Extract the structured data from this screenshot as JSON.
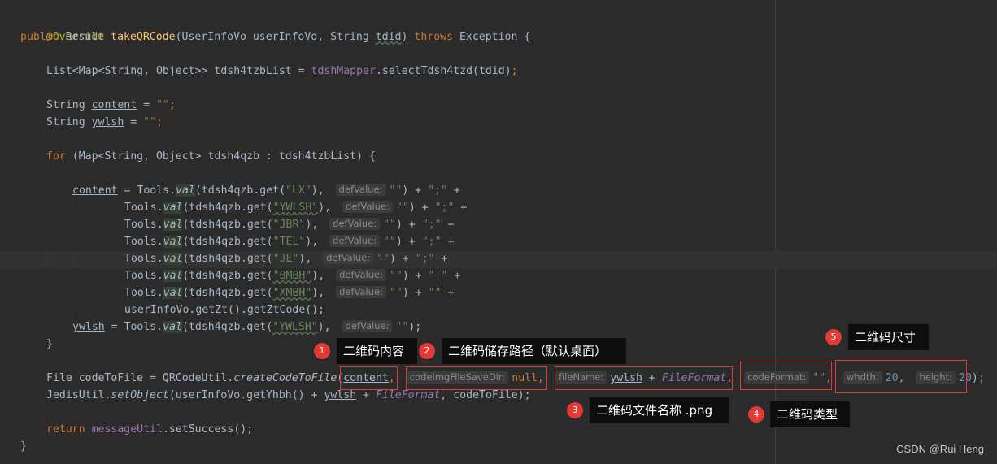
{
  "code": {
    "l1_annotation": "@Override",
    "l2": {
      "kw_public": "public",
      "type_result": " Result ",
      "method": "takeQRCode",
      "params": "(UserInfoVo userInfoVo, String ",
      "tdid": "tdid",
      "close": ") ",
      "kw_throws": "throws",
      "exception": " Exception {"
    },
    "l4": {
      "decl": "List<Map<String, Object>> tdsh4tzbList = ",
      "mapper": "tdshMapper",
      "call": ".selectTdsh4tzd(tdid)",
      "semi": ";"
    },
    "l6": {
      "type": "String ",
      "var": "content",
      "eq": " = ",
      "str": "\"\"",
      "semi": ";"
    },
    "l7": {
      "type": "String ",
      "var": "ywlsh",
      "eq": " = ",
      "str": "\"\"",
      "semi": ";"
    },
    "l9": {
      "kw_for": "for",
      "rest": " (Map<String, Object> tdsh4qzb : tdsh4tzbList) {"
    },
    "tools_rows": [
      {
        "prefix_var": "content",
        "prefix_eq": " = ",
        "call": "Tools.",
        "val": "val",
        "get": "(tdsh4qzb.get(",
        "key": "\"LX\"",
        "after_key": "), ",
        "hint": "defValue:",
        "def": "\"\"",
        "tail": ") + ",
        "sep": "\";\"",
        "end": " +"
      },
      {
        "prefix_var": "",
        "prefix_eq": "",
        "call": "Tools.",
        "val": "val",
        "get": "(tdsh4qzb.get(",
        "key": "\"YWLSH\"",
        "after_key": "), ",
        "hint": "defValue:",
        "def": "\"\"",
        "tail": ") + ",
        "sep": "\";\"",
        "end": " +"
      },
      {
        "prefix_var": "",
        "prefix_eq": "",
        "call": "Tools.",
        "val": "val",
        "get": "(tdsh4qzb.get(",
        "key": "\"JBR\"",
        "after_key": "), ",
        "hint": "defValue:",
        "def": "\"\"",
        "tail": ") + ",
        "sep": "\";\"",
        "end": " +"
      },
      {
        "prefix_var": "",
        "prefix_eq": "",
        "call": "Tools.",
        "val": "val",
        "get": "(tdsh4qzb.get(",
        "key": "\"TEL\"",
        "after_key": "), ",
        "hint": "defValue:",
        "def": "\"\"",
        "tail": ") + ",
        "sep": "\";\"",
        "end": " +"
      },
      {
        "prefix_var": "",
        "prefix_eq": "",
        "call": "Tools.",
        "val": "val",
        "get": "(tdsh4qzb.get(",
        "key": "\"JE\"",
        "after_key": "), ",
        "hint": "defValue:",
        "def": "\"\"",
        "tail": ") + ",
        "sep": "\";\"",
        "end": " +"
      },
      {
        "prefix_var": "",
        "prefix_eq": "",
        "call": "Tools.",
        "val": "val",
        "get": "(tdsh4qzb.get(",
        "key": "\"BMBH\"",
        "after_key": "), ",
        "hint": "defValue:",
        "def": "\"\"",
        "tail": ") + ",
        "sep": "\"|\"",
        "end": " +"
      },
      {
        "prefix_var": "",
        "prefix_eq": "",
        "call": "Tools.",
        "val": "val",
        "get": "(tdsh4qzb.get(",
        "key": "\"XMBH\"",
        "after_key": "), ",
        "hint": "defValue:",
        "def": "\"\"",
        "tail": ") + ",
        "sep": "\"\"",
        "end": " +"
      }
    ],
    "l17": "userInfoVo.getZt().getZtCode();",
    "l18": {
      "var": "ywlsh",
      "eq": " = ",
      "call": "Tools.",
      "val": "val",
      "get": "(tdsh4qzb.get(",
      "key": "\"YWLSH\"",
      "after_key": "), ",
      "hint": "defValue:",
      "def": "\"\"",
      "end": ");"
    },
    "l19": "}",
    "l21": {
      "decl": "File codeToFile = QRCodeUtil.",
      "method": "createCodeToFile",
      "open": "(",
      "arg_content": "content",
      "comma1": ", ",
      "hint_dir": "codeImgFileSaveDir:",
      "null_kw": "null",
      "comma2": ", ",
      "hint_name": "fileName:",
      "arg_ywlsh": "ywlsh",
      "plus": " + ",
      "fmt": "FileFormat",
      "comma3": ", ",
      "hint_fmt": "codeFormat:",
      "str_empty": "\"\"",
      "comma4": ", ",
      "hint_w": "whdth:",
      "w": "20",
      "comma5": ", ",
      "hint_h": "height:",
      "h": "20",
      "close": ")",
      "semi": ";"
    },
    "l22": {
      "pre": "JedisUtil.",
      "method": "setObject",
      "args": "(userInfoVo.getYhbh() + ",
      "ywlsh": "ywlsh",
      "plus": " + ",
      "fmt": "FileFormat",
      "end": ", codeToFile);"
    },
    "l24": {
      "kw_return": "return",
      "sp": " ",
      "util": "messageUtil",
      "call": ".setSuccess();"
    },
    "l25": "}"
  },
  "callouts": [
    {
      "num": "1",
      "label": "二维码内容"
    },
    {
      "num": "2",
      "label": "二维码储存路径（默认桌面）"
    },
    {
      "num": "3",
      "label": "二维码文件名称 .png"
    },
    {
      "num": "4",
      "label": "二维码类型"
    },
    {
      "num": "5",
      "label": "二维码尺寸"
    }
  ],
  "watermark": "CSDN @Rui Heng",
  "colors": {
    "background": "#2b2b2b",
    "keyword": "#cc7832",
    "string": "#6a8759",
    "method": "#ffc66d",
    "annotation_red": "#e53935"
  }
}
